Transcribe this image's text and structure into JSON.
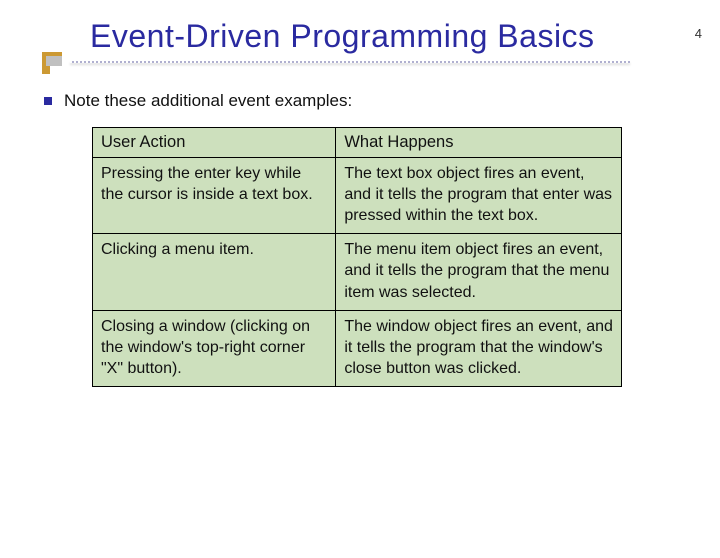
{
  "page_number": "4",
  "title": "Event-Driven Programming Basics",
  "intro": "Note these additional event examples:",
  "table": {
    "headers": {
      "action": "User Action",
      "result": "What Happens"
    },
    "rows": [
      {
        "action": "Pressing the enter key while the cursor is inside a text box.",
        "result": "The text box object fires an event, and it tells the program that enter was pressed within the text box."
      },
      {
        "action": "Clicking a menu item.",
        "result": "The menu item object fires an event, and it tells the program that the menu item was selected."
      },
      {
        "action": "Closing a window (clicking on the window's top-right corner \"X\" button).",
        "result": "The window object fires an event, and it tells the program that the window's close button was clicked."
      }
    ]
  }
}
